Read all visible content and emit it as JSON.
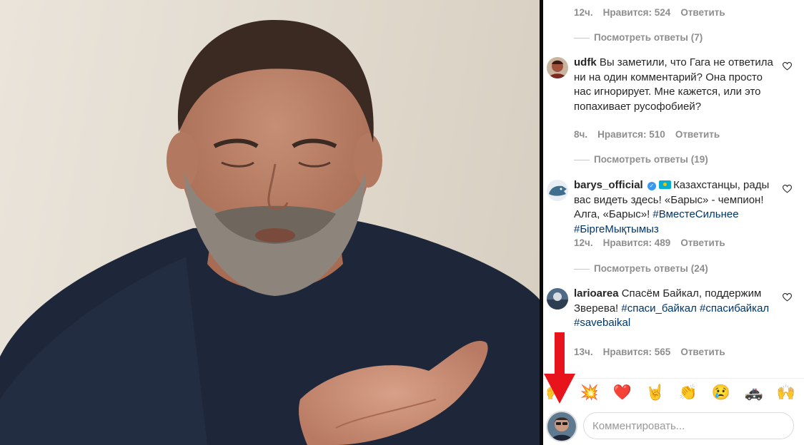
{
  "top_comment_meta": {
    "time": "12ч.",
    "likes": "Нравится: 524",
    "reply": "Ответить"
  },
  "top_view_replies": "Посмотреть ответы (7)",
  "comments": [
    {
      "username": "udfk",
      "text": "Вы заметили, что Гага не ответила ни на один комментарий? Она просто нас игнорирует. Мне кажется, или это попахивает русофобией?",
      "time": "8ч.",
      "likes": "Нравится: 510",
      "reply": "Ответить",
      "view_replies": "Посмотреть ответы (19)"
    },
    {
      "username": "barys_official",
      "text": "Казахстанцы, рады вас видеть здесь! «Барыс» - чемпион! Алга, «Барыс»!",
      "tags": "#ВместеСильнее #БіргеМықтымыз",
      "time": "12ч.",
      "likes": "Нравится: 489",
      "reply": "Ответить",
      "view_replies": "Посмотреть ответы (24)"
    },
    {
      "username": "larioarea",
      "text": "Спасём Байкал, поддержим Зверева!",
      "tags": "#спаси_байкал #спасибайкал #savebaikal",
      "time": "13ч.",
      "likes": "Нравится: 565",
      "reply": "Ответить"
    }
  ],
  "emoji_bar": [
    "🙌",
    "💥",
    "❤️",
    "🤘",
    "👏",
    "😢",
    "🚓",
    "🙌"
  ],
  "comment_input": {
    "placeholder": "Комментировать..."
  },
  "colors": {
    "annotation_arrow": "#e8141c",
    "hashtag": "#003569",
    "meta_gray": "#8e8e8e",
    "verified": "#3897f0"
  }
}
